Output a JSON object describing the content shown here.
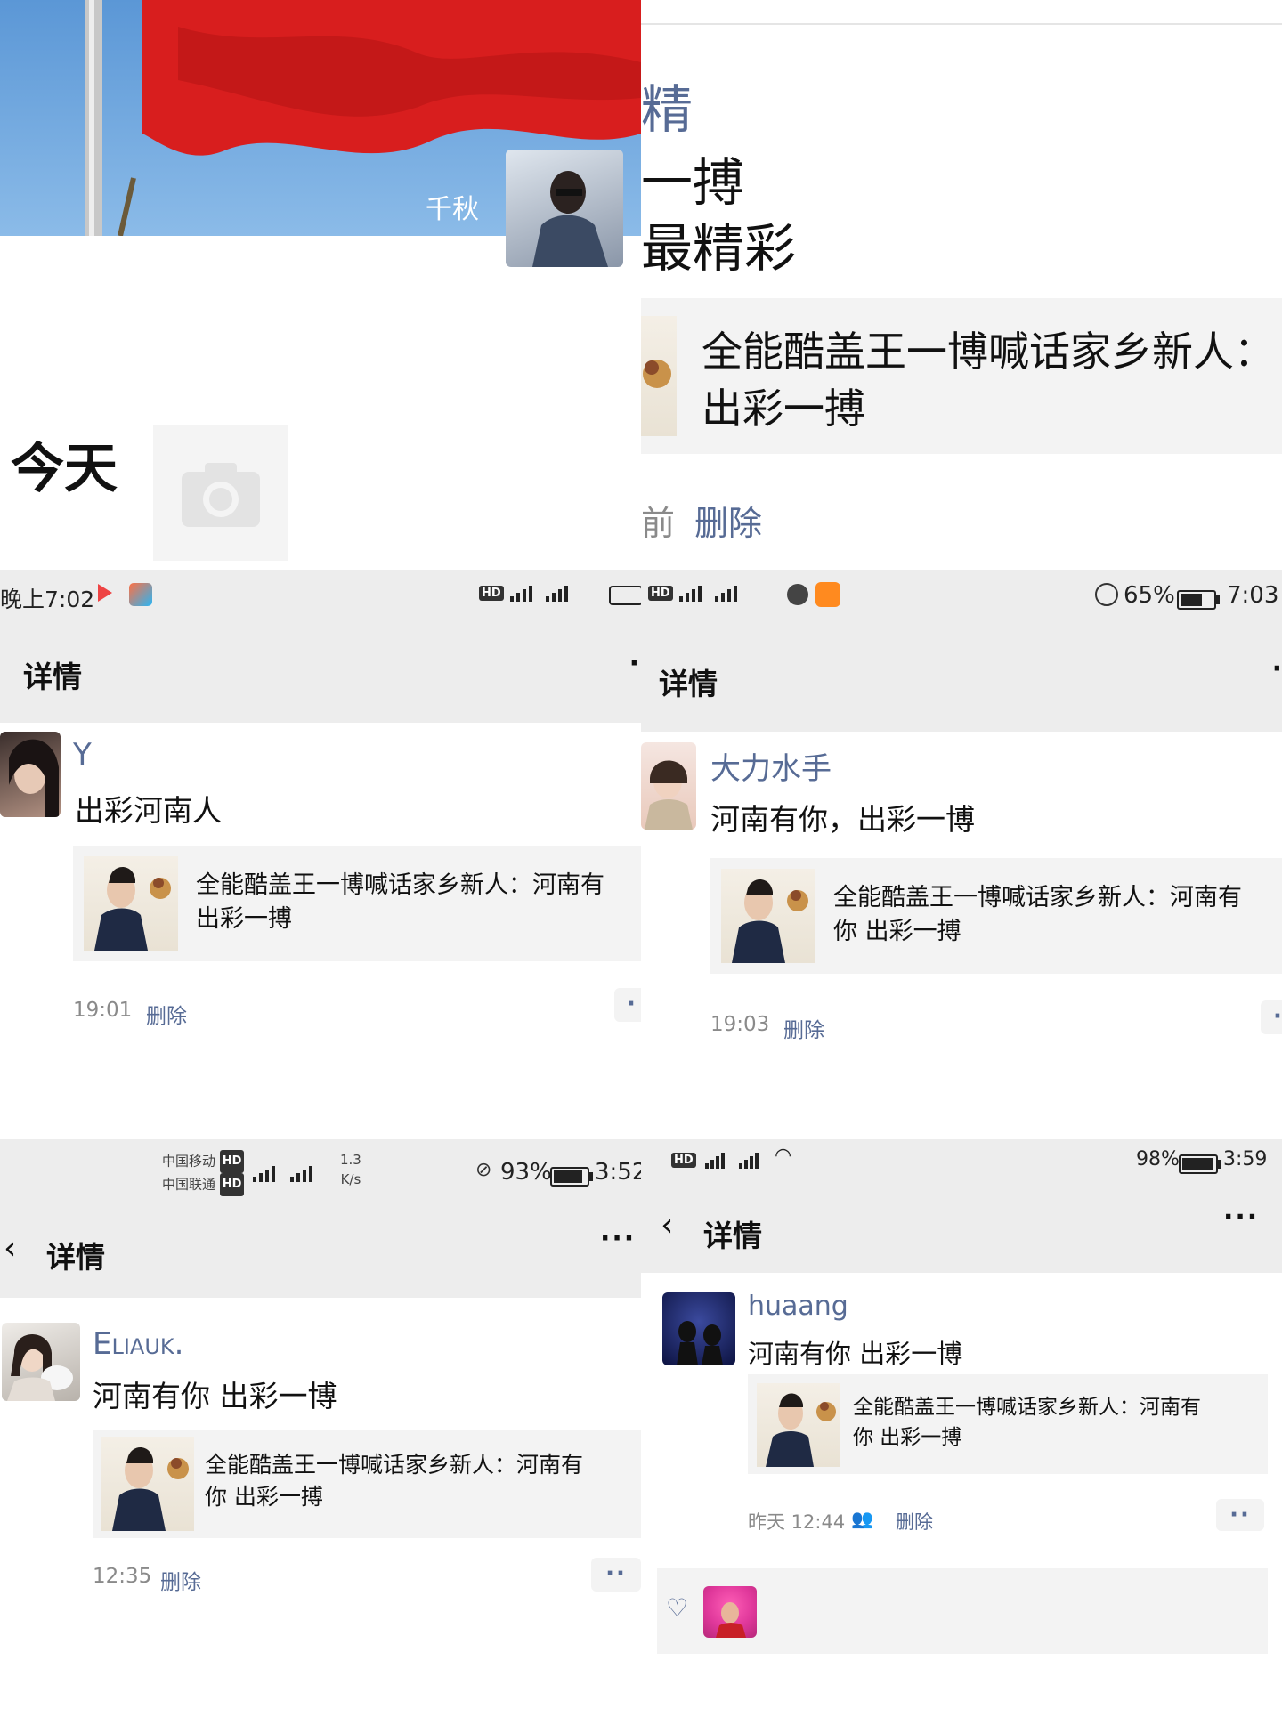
{
  "panel1": {
    "nickname": "千秋",
    "today_label": "今天"
  },
  "panel2": {
    "line1": "精",
    "line2": "一搏",
    "line3": "最精彩",
    "card_title": "全能酷盖王一博喊话家乡新人：",
    "card_title_line2": "出彩一搏",
    "time_fragment": "前",
    "delete_label": "删除"
  },
  "panel3": {
    "status_time": "晚上7:02",
    "title": "详情",
    "username": "Y",
    "text": "出彩河南人",
    "card_line1": "全能酷盖王一博喊话家乡新人：河南有",
    "card_line2": "出彩一搏",
    "time": "19:01",
    "delete_label": "删除"
  },
  "panel4": {
    "status_battery": "65%",
    "status_time": "7:03",
    "title": "详情",
    "username": "大力水手",
    "text": "河南有你，出彩一博",
    "card_line1": "全能酷盖王一博喊话家乡新人：河南有",
    "card_line2": "你 出彩一搏",
    "time": "19:03",
    "delete_label": "删除"
  },
  "panel5": {
    "carrier1": "中国移动",
    "carrier2": "中国联通",
    "net_speed": "1.3",
    "net_unit": "K/s",
    "status_battery": "93%",
    "status_time": "3:52",
    "title": "详情",
    "username": "Eliauk.",
    "text": "河南有你 出彩一博",
    "card_line1": "全能酷盖王一博喊话家乡新人：河南有",
    "card_line2": "你 出彩一搏",
    "time": "12:35",
    "delete_label": "删除"
  },
  "panel6": {
    "status_battery": "98%",
    "status_time": "3:59",
    "title": "详情",
    "username": "huaang",
    "text": "河南有你 出彩一博",
    "card_line1": "全能酷盖王一博喊话家乡新人：河南有",
    "card_line2": "你 出彩一搏",
    "time": "昨天 12:44",
    "delete_label": "删除"
  },
  "icons": {
    "more": "more-dots-icon",
    "back": "chevron-left-icon",
    "camera": "camera-icon",
    "heart": "heart-icon",
    "friends": "friends-icon"
  },
  "colors": {
    "link": "#576b95",
    "nav_bg": "#ededed",
    "card_bg": "#f3f3f3",
    "flag_red": "#d81e1e",
    "sky": "#6fa7df"
  }
}
